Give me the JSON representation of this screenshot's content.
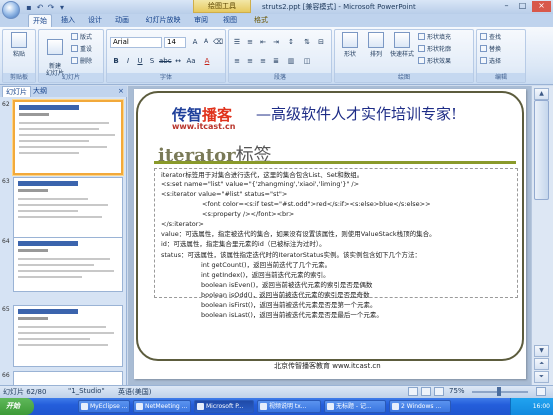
{
  "window": {
    "title": "struts2.ppt [兼容模式] - Microsoft PowerPoint",
    "context_tab_group": "绘图工具"
  },
  "ribbon": {
    "tabs": [
      "开始",
      "插入",
      "设计",
      "动画",
      "幻灯片放映",
      "审阅",
      "视图",
      "格式"
    ],
    "active_tab": "开始",
    "groups": {
      "clipboard": {
        "label": "剪贴板",
        "paste": "粘贴"
      },
      "slides": {
        "label": "幻灯片",
        "new_slide": "新建\n幻灯片",
        "layout": "版式",
        "reset": "重设",
        "delete": "删除"
      },
      "font": {
        "label": "字体",
        "font_name": "Arial",
        "font_size": "14"
      },
      "paragraph": {
        "label": "段落"
      },
      "drawing": {
        "label": "绘图",
        "shapes": "形状",
        "arrange": "排列",
        "quick_styles": "快速样式",
        "fill": "形状填充",
        "outline": "形状轮廓",
        "effects": "形状效果"
      },
      "editing": {
        "label": "编辑",
        "find": "查找",
        "replace": "替换",
        "select": "选择"
      }
    }
  },
  "left_pane": {
    "tabs": [
      "幻灯片",
      "大纲"
    ],
    "close": "×",
    "slide_numbers": [
      "62",
      "63",
      "64",
      "65",
      "66"
    ],
    "selected_slide": "62"
  },
  "slide": {
    "logo": {
      "part1": "传智",
      "part2": "播客",
      "url": "www.itcast.cn"
    },
    "slogan": "—高级软件人才实作培训专家!",
    "title_en": "iterator",
    "title_cn": "标签",
    "lines": [
      "iterator标签用于对集合进行迭代，这里的集合包含List、Set和数组。",
      "<s:set name=\"list\" value=\"{'zhangming','xiaoi','liming'}\" />",
      "<s:iterator value=\"#list\" status=\"st\">",
      "<font color=<s:if test=\"#st.odd\">red</s:if><s:else>blue</s:else>>",
      "<s:property /></font><br>",
      "</s:iterator>",
      "value：可选属性，指定被迭代的集合，如果没有设置该属性，则使用ValueStack栈顶的集合。",
      "id：可选属性，指定集合里元素的id（已被标注为过时）。",
      "status：可选属性，该属性指定迭代时的IteratorStatus实例。该实例包含如下几个方法：",
      "int getCount()，返回当前迭代了几个元素。",
      "int getIndex()，返回当前迭代元素的索引。",
      "boolean isEven()，返回当前被迭代元素的索引是否是偶数",
      "boolean isOdd()，返回当前被迭代元素的索引是否是奇数",
      "boolean isFirst()，返回当前被迭代元素是否是第一个元素。",
      "boolean isLast()，返回当前被迭代元素是否是最后一个元素。"
    ],
    "footer": "北京传智播客教育 www.itcast.cn"
  },
  "status_bar": {
    "slide_info": "幻灯片 62/80",
    "theme": "\"1_Studio\"",
    "language": "英语(美国)",
    "zoom": "75%"
  },
  "taskbar": {
    "start": "开始",
    "buttons": [
      "MyEclipse ...",
      "NetMeeting ...",
      "Microsoft P...",
      "视频说明 tx...",
      "无标题 - 记...",
      "2 Windows ..."
    ],
    "active_index": 2,
    "clock": "16:00"
  }
}
